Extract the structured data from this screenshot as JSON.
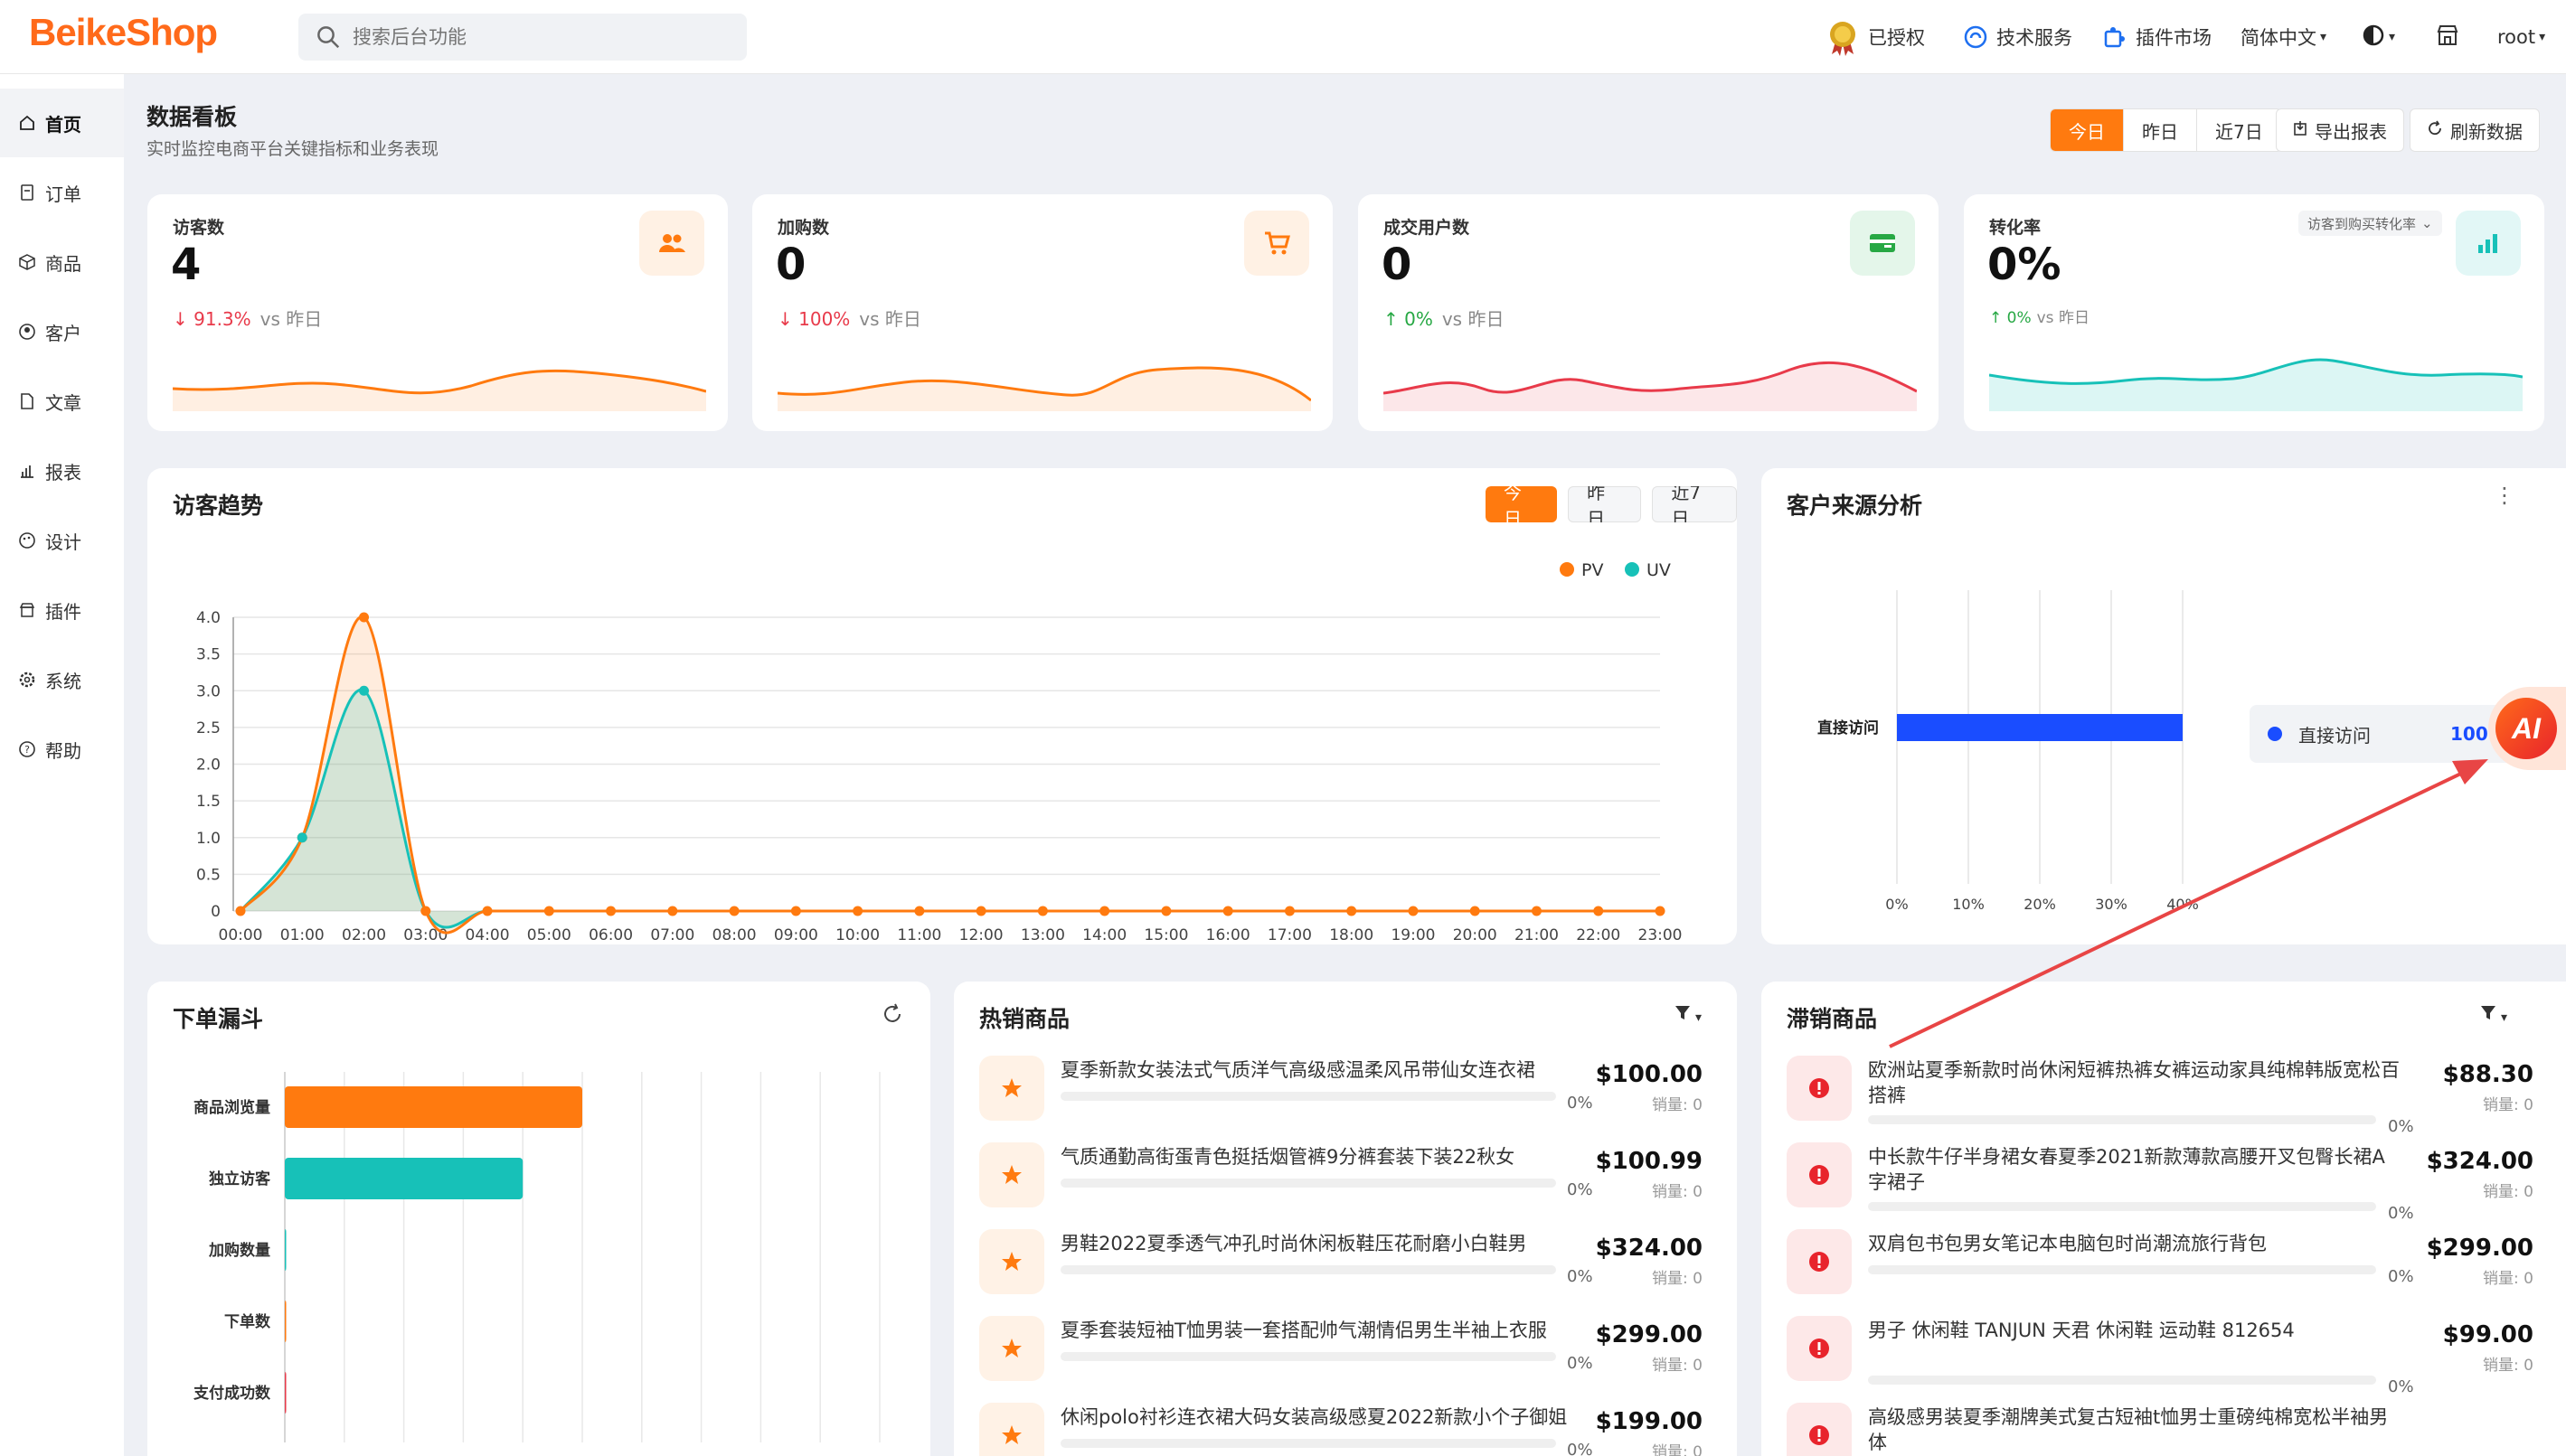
{
  "brand": {
    "name": "BeikeShop",
    "color": "#ff6a1a"
  },
  "search": {
    "placeholder": "搜索后台功能"
  },
  "topnav": {
    "authorized": "已授权",
    "tech_service": "技术服务",
    "plugin_market": "插件市场",
    "language": "简体中文",
    "user": "root"
  },
  "sidebar": {
    "items": [
      {
        "label": "首页",
        "icon": "home-icon",
        "active": true
      },
      {
        "label": "订单",
        "icon": "order-icon"
      },
      {
        "label": "商品",
        "icon": "box-icon"
      },
      {
        "label": "客户",
        "icon": "user-icon"
      },
      {
        "label": "文章",
        "icon": "document-icon"
      },
      {
        "label": "报表",
        "icon": "bar-chart-icon"
      },
      {
        "label": "设计",
        "icon": "palette-icon"
      },
      {
        "label": "插件",
        "icon": "store-icon"
      },
      {
        "label": "系统",
        "icon": "gear-icon"
      },
      {
        "label": "帮助",
        "icon": "help-icon"
      }
    ]
  },
  "header": {
    "title": "数据看板",
    "subtitle": "实时监控电商平台关键指标和业务表现",
    "ranges": [
      "今日",
      "昨日",
      "近7日"
    ],
    "export": "导出报表",
    "refresh": "刷新数据"
  },
  "kpis": [
    {
      "label": "访客数",
      "value": "4",
      "change": "↓ 91.3%",
      "vs": "vs 昨日",
      "trend": "down",
      "color": "#ff7a0f"
    },
    {
      "label": "加购数",
      "value": "0",
      "change": "↓ 100%",
      "vs": "vs 昨日",
      "trend": "down",
      "color": "#ff7a0f"
    },
    {
      "label": "成交用户数",
      "value": "0",
      "change": "↑ 0%",
      "vs": "vs 昨日",
      "trend": "up",
      "color": "#e83a4a"
    },
    {
      "label": "转化率",
      "value": "0%",
      "change": "↑ 0%",
      "vs": "vs 昨日",
      "trend": "up",
      "color": "#17c1b8",
      "selector": "访客到购买转化率"
    }
  ],
  "visitor_trend": {
    "title": "访客趋势",
    "ranges": [
      "今日",
      "昨日",
      "近7日"
    ]
  },
  "source": {
    "title": "客户来源分析",
    "legend_label": "直接访问",
    "legend_value": "100%"
  },
  "funnel": {
    "title": "下单漏斗"
  },
  "hot": {
    "title": "热销商品",
    "items": [
      {
        "name": "夏季新款女装法式气质洋气高级感温柔风吊带仙女连衣裙",
        "pct": "0%",
        "price": "$100.00",
        "sales": "销量: 0"
      },
      {
        "name": "气质通勤高街蛋青色挺括烟管裤9分裤套装下装22秋女",
        "pct": "0%",
        "price": "$100.99",
        "sales": "销量: 0"
      },
      {
        "name": "男鞋2022夏季透气冲孔时尚休闲板鞋压花耐磨小白鞋男",
        "pct": "0%",
        "price": "$324.00",
        "sales": "销量: 0"
      },
      {
        "name": "夏季套装短袖T恤男装一套搭配帅气潮情侣男生半袖上衣服",
        "pct": "0%",
        "price": "$299.00",
        "sales": "销量: 0"
      },
      {
        "name": "休闲polo衬衫连衣裙大码女装高级感夏2022新款小个子御姐",
        "pct": "0%",
        "price": "$199.00",
        "sales": "销量: 0"
      }
    ]
  },
  "slow": {
    "title": "滞销商品",
    "items": [
      {
        "name": "欧洲站夏季新款时尚休闲短裤热裤女裤运动家具纯棉韩版宽松百搭裤",
        "pct": "0%",
        "price": "$88.30",
        "sales": "销量: 0"
      },
      {
        "name": "中长款牛仔半身裙女春夏季2021新款薄款高腰开叉包臀长裙A字裙子",
        "pct": "0%",
        "price": "$324.00",
        "sales": "销量: 0"
      },
      {
        "name": "双肩包书包男女笔记本电脑包时尚潮流旅行背包",
        "pct": "0%",
        "price": "$299.00",
        "sales": "销量: 0"
      },
      {
        "name": "男子 休闲鞋 TANJUN 天君 休闲鞋 运动鞋 812654",
        "pct": "0%",
        "price": "$99.00",
        "sales": "销量: 0"
      },
      {
        "name": "高级感男装夏季潮牌美式复古短袖t恤男士重磅纯棉宽松半袖男体",
        "pct": "",
        "price": "",
        "sales": ""
      }
    ]
  },
  "ai_badge": {
    "label": "AI"
  },
  "chart_data": [
    {
      "type": "line",
      "title": "访客趋势",
      "categories": [
        "00:00",
        "01:00",
        "02:00",
        "03:00",
        "04:00",
        "05:00",
        "06:00",
        "07:00",
        "08:00",
        "09:00",
        "10:00",
        "11:00",
        "12:00",
        "13:00",
        "14:00",
        "15:00",
        "16:00",
        "17:00",
        "18:00",
        "19:00",
        "20:00",
        "21:00",
        "22:00",
        "23:00"
      ],
      "series": [
        {
          "name": "PV",
          "color": "#ff7a0f",
          "values": [
            0,
            1,
            4,
            0,
            0,
            0,
            0,
            0,
            0,
            0,
            0,
            0,
            0,
            0,
            0,
            0,
            0,
            0,
            0,
            0,
            0,
            0,
            0,
            0
          ]
        },
        {
          "name": "UV",
          "color": "#17c1b8",
          "values": [
            0,
            1,
            3,
            0,
            0,
            0,
            0,
            0,
            0,
            0,
            0,
            0,
            0,
            0,
            0,
            0,
            0,
            0,
            0,
            0,
            0,
            0,
            0,
            0
          ]
        }
      ],
      "ylim": [
        0,
        4
      ],
      "yticks": [
        "0",
        "0.5",
        "1.0",
        "1.5",
        "2.0",
        "2.5",
        "3.0",
        "3.5",
        "4.0"
      ],
      "legend": "top-right",
      "grid": true
    },
    {
      "type": "bar",
      "title": "客户来源分析",
      "orientation": "horizontal",
      "categories": [
        "直接访问"
      ],
      "values": [
        40
      ],
      "xticks": [
        "0%",
        "10%",
        "20%",
        "30%",
        "40%"
      ],
      "xlim": [
        0,
        40
      ],
      "color": "#1a4dff"
    },
    {
      "type": "bar",
      "title": "下单漏斗",
      "orientation": "horizontal",
      "categories": [
        "商品浏览量",
        "独立访客",
        "加购数量",
        "下单数",
        "支付成功数"
      ],
      "values": [
        5,
        4,
        0,
        0,
        0
      ],
      "colors": [
        "#ff7a0f",
        "#17c1b8",
        "#17c1b8",
        "#ff7a0f",
        "#e83a4a"
      ],
      "xlim": [
        0,
        10
      ],
      "xticks": [
        "0",
        "1",
        "2",
        "3",
        "4",
        "5",
        "6",
        "7",
        "8",
        "9",
        "10"
      ]
    }
  ]
}
